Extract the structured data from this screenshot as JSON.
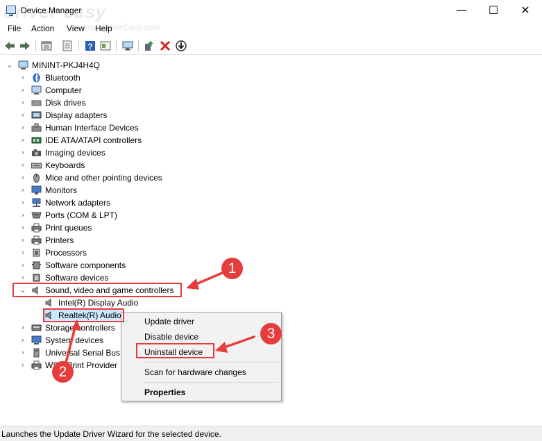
{
  "window": {
    "title": "Device Manager",
    "watermark": "driver easy",
    "watermark_url": "www.DriverEasy.com",
    "minimize": "—",
    "maximize": "☐",
    "close": "✕"
  },
  "menu": {
    "file": "File",
    "action": "Action",
    "view": "View",
    "help": "Help"
  },
  "toolbar_icons": [
    "back-icon",
    "forward-icon",
    "properties-icon",
    "update-driver-icon",
    "help-icon",
    "details-icon",
    "monitor-icon",
    "add-legacy-icon",
    "uninstall-icon",
    "download-icon"
  ],
  "tree": {
    "root": "MININT-PKJ4H4Q",
    "categories": [
      "Bluetooth",
      "Computer",
      "Disk drives",
      "Display adapters",
      "Human Interface Devices",
      "IDE ATA/ATAPI controllers",
      "Imaging devices",
      "Keyboards",
      "Mice and other pointing devices",
      "Monitors",
      "Network adapters",
      "Ports (COM & LPT)",
      "Print queues",
      "Printers",
      "Processors",
      "Software components",
      "Software devices"
    ],
    "expanded_category": "Sound, video and game controllers",
    "children": [
      "Intel(R) Display Audio",
      "Realtek(R) Audio"
    ],
    "after_categories": [
      "Storage controllers",
      "System devices",
      "Universal Serial Bus c",
      "WSD Print Provider"
    ]
  },
  "context_menu": {
    "update": "Update driver",
    "disable": "Disable device",
    "uninstall": "Uninstall device",
    "scan": "Scan for hardware changes",
    "properties": "Properties"
  },
  "annotations": {
    "step1": "1",
    "step2": "2",
    "step3": "3"
  },
  "status": "Launches the Update Driver Wizard for the selected device.",
  "colors": {
    "annotation": "#e53d3d",
    "selection": "#cce8ff"
  }
}
